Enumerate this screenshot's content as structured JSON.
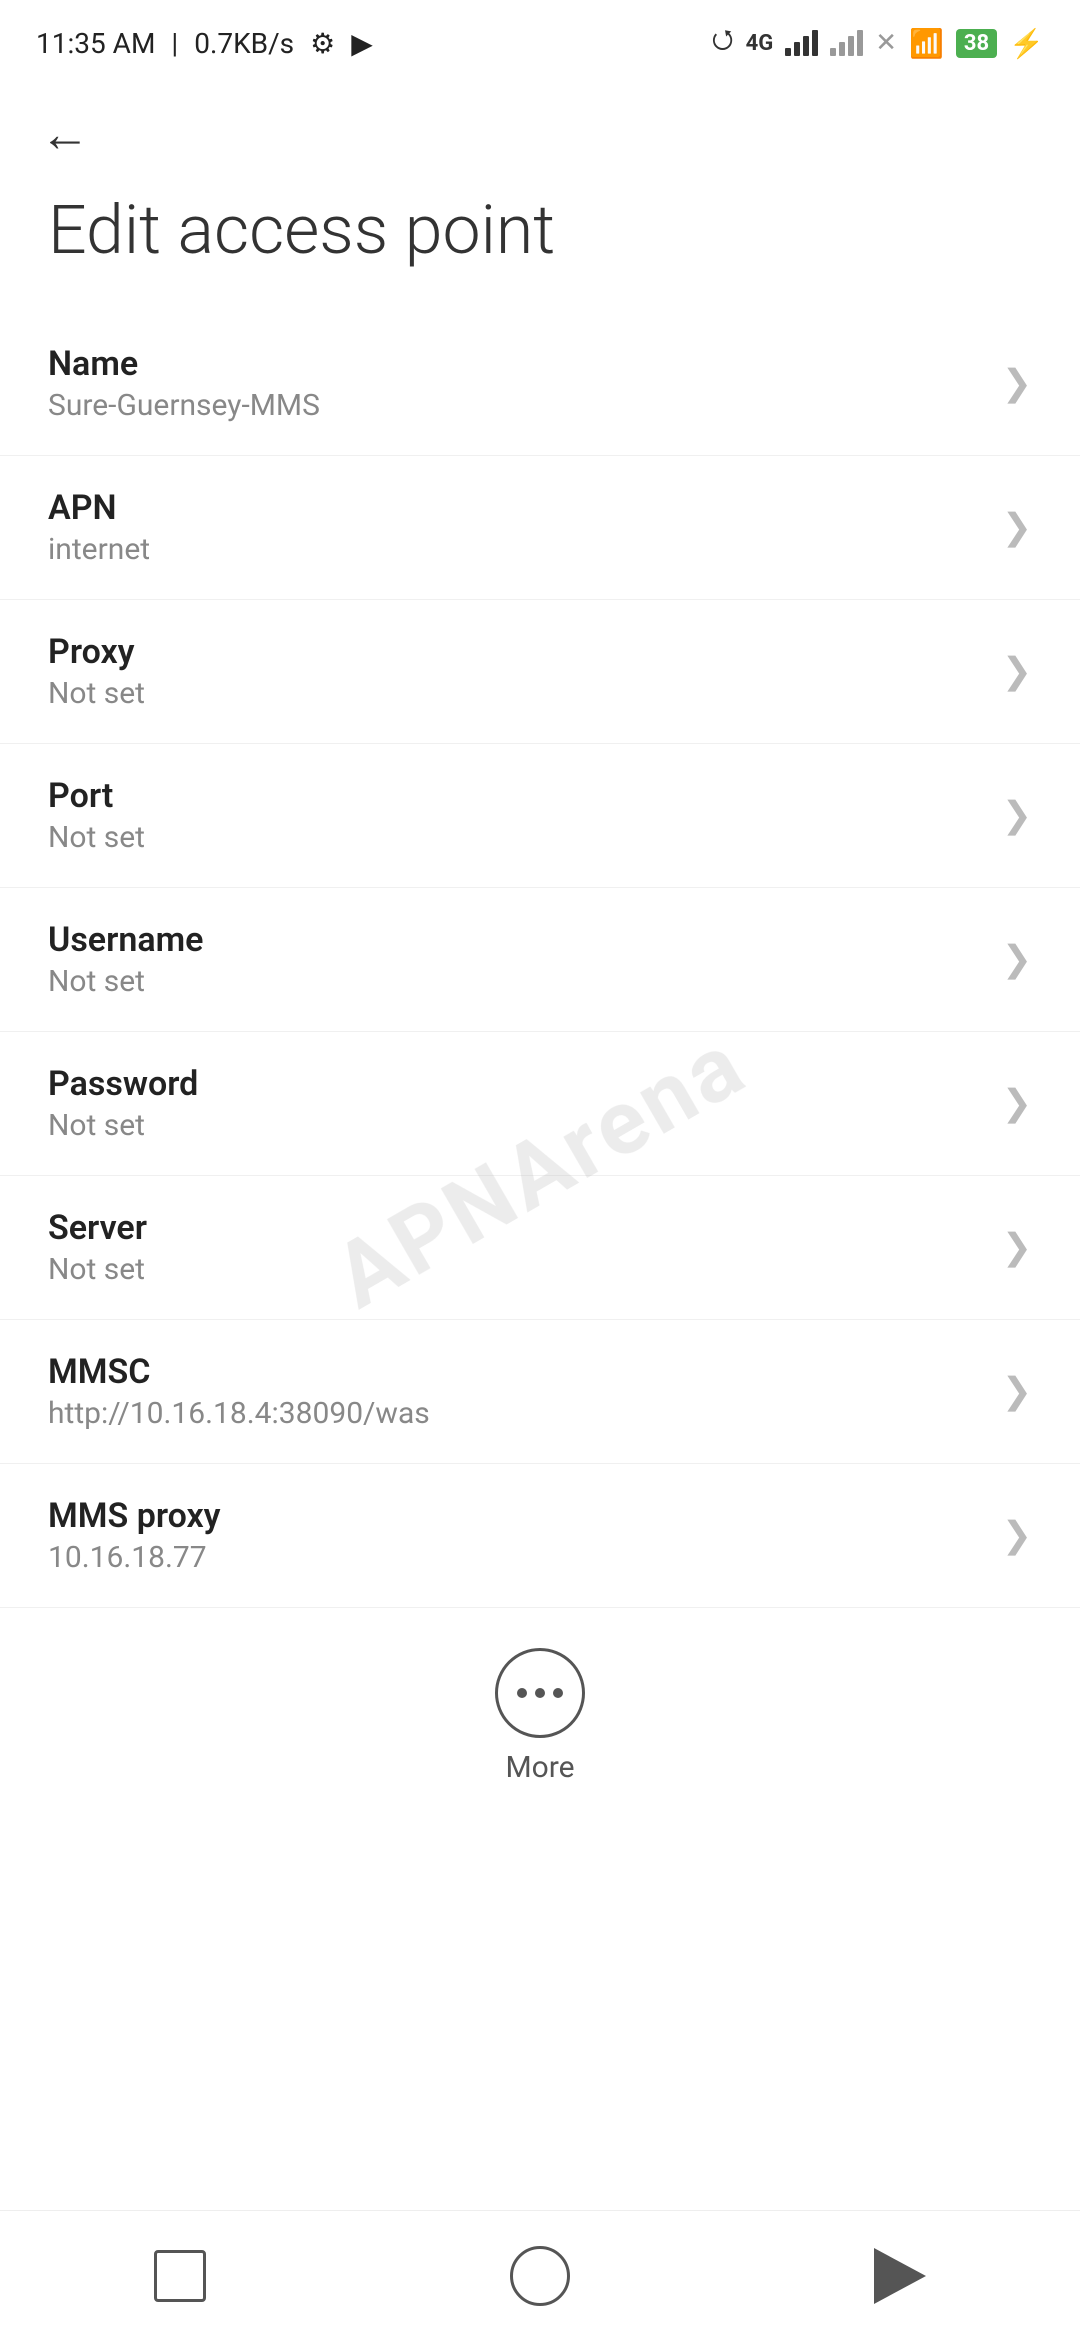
{
  "statusBar": {
    "time": "11:35 AM",
    "speed": "0.7KB/s",
    "battery": "38"
  },
  "header": {
    "backLabel": "←",
    "title": "Edit access point"
  },
  "settings": {
    "items": [
      {
        "label": "Name",
        "value": "Sure-Guernsey-MMS"
      },
      {
        "label": "APN",
        "value": "internet"
      },
      {
        "label": "Proxy",
        "value": "Not set"
      },
      {
        "label": "Port",
        "value": "Not set"
      },
      {
        "label": "Username",
        "value": "Not set"
      },
      {
        "label": "Password",
        "value": "Not set"
      },
      {
        "label": "Server",
        "value": "Not set"
      },
      {
        "label": "MMSC",
        "value": "http://10.16.18.4:38090/was"
      },
      {
        "label": "MMS proxy",
        "value": "10.16.18.77"
      }
    ]
  },
  "moreButton": {
    "label": "More"
  },
  "watermark": "APNArena"
}
